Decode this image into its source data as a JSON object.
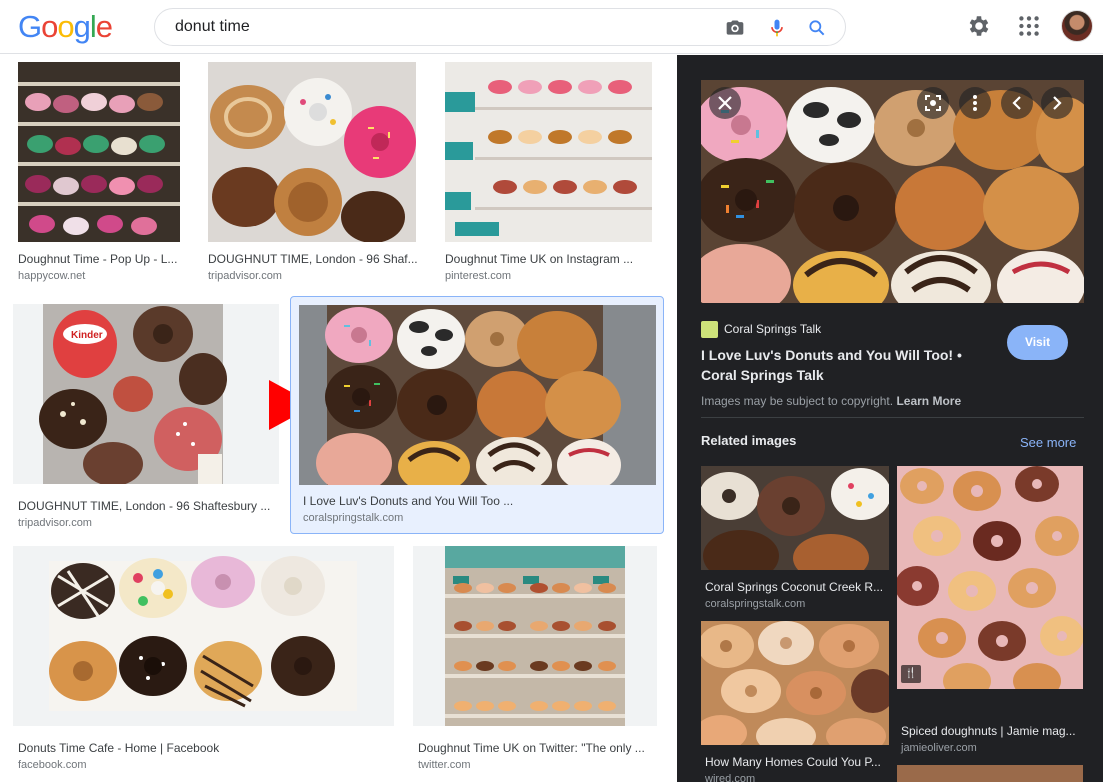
{
  "logo": [
    "G",
    "o",
    "o",
    "g",
    "l",
    "e"
  ],
  "search": {
    "query": "donut time"
  },
  "icons": {
    "camera": "camera-icon",
    "mic": "microphone-icon",
    "search": "search-icon",
    "settings": "gear-icon",
    "apps": "apps-grid-icon"
  },
  "results": [
    {
      "title": "Doughnut Time - Pop Up - L...",
      "source": "happycow.net"
    },
    {
      "title": "DOUGHNUT TIME, London - 96 Shaf...",
      "source": "tripadvisor.com"
    },
    {
      "title": "Doughnut Time UK on Instagram ...",
      "source": "pinterest.com"
    },
    {
      "title": "DOUGHNUT TIME, London - 96 Shaftesbury ...",
      "source": "tripadvisor.com"
    },
    {
      "title": "I Love Luv's Donuts and You Will Too ...",
      "source": "coralspringstalk.com"
    },
    {
      "title": "Donuts Time Cafe - Home | Facebook",
      "source": "facebook.com"
    },
    {
      "title": "Doughnut Time UK on Twitter: \"The only ...",
      "source": "twitter.com"
    }
  ],
  "panel": {
    "site_name": "Coral Springs Talk",
    "title": "I Love Luv's Donuts and You Will Too! • Coral Springs Talk",
    "visit_label": "Visit",
    "copyright_text": "Images may be subject to copyright.",
    "learn_more": "Learn More",
    "related_heading": "Related images",
    "see_more": "See more",
    "related": [
      {
        "title": "Coral Springs Coconut Creek R...",
        "source": "coralspringstalk.com"
      },
      {
        "title": "Spiced doughnuts | Jamie mag...",
        "source": "jamieoliver.com"
      },
      {
        "title": "How Many Homes Could You P...",
        "source": "wired.com"
      }
    ]
  },
  "colors": {
    "accent": "#8ab4f8",
    "panel_bg": "#202124",
    "selected_bg": "#e8f0fe"
  }
}
